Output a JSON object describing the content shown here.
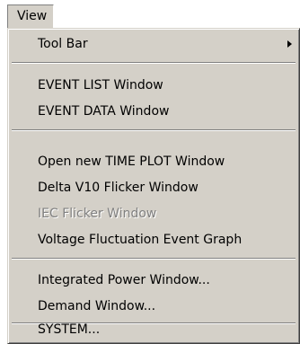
{
  "menubar": {
    "view_label": "View"
  },
  "menu": {
    "tool_bar": "Tool Bar",
    "event_list": "EVENT LIST Window",
    "event_data": "EVENT DATA Window",
    "open_time_plot": "Open new TIME PLOT Window",
    "delta_v10": "Delta V10 Flicker Window",
    "iec_flicker": "IEC Flicker Window",
    "voltage_fluctuation": "Voltage Fluctuation Event Graph",
    "integrated_power": "Integrated Power Window...",
    "demand": "Demand Window...",
    "system": "SYSTEM..."
  },
  "icons": {
    "submenu_arrow": "submenu-arrow-icon"
  }
}
